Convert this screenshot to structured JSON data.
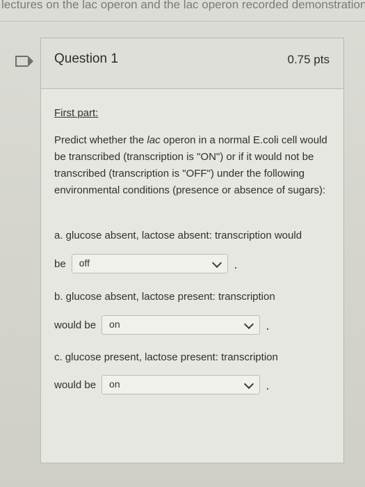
{
  "top": {
    "text": "lectures on the lac operon and the lac operon recorded demonstration."
  },
  "question": {
    "title": "Question 1",
    "points": "0.75 pts",
    "part_label": "First part:",
    "prompt": {
      "p1": "Predict whether the ",
      "italic": "lac",
      "p2": " operon in a normal E.coli cell would be transcribed (transcription is \"ON\") or if it would not be transcribed (transcription is \"OFF\") under the following environmental conditions (presence or absence of sugars):"
    },
    "items": [
      {
        "title": "a. glucose absent, lactose absent: transcription would",
        "lead": "be",
        "selected": "off"
      },
      {
        "title": "b. glucose absent, lactose present: transcription",
        "lead": "would be",
        "selected": "on"
      },
      {
        "title": "c. glucose present, lactose present: transcription",
        "lead": "would be",
        "selected": "on"
      }
    ]
  }
}
